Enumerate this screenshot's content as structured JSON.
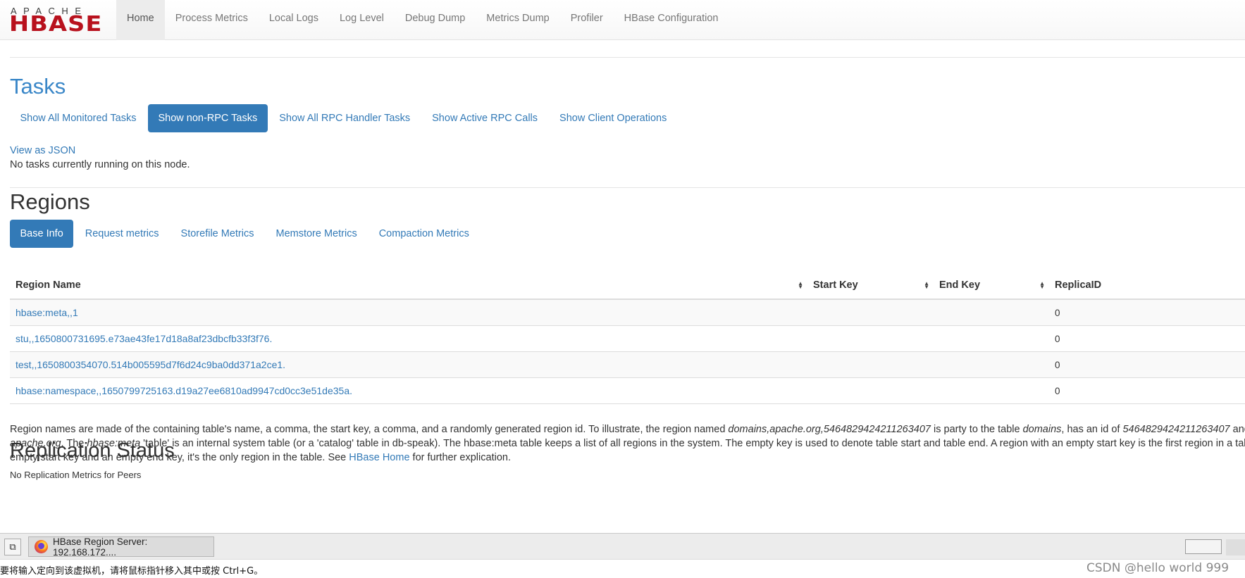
{
  "logo": {
    "top": "APACHE",
    "bottom": "HBASE"
  },
  "nav": [
    {
      "label": "Home",
      "active": true
    },
    {
      "label": "Process Metrics"
    },
    {
      "label": "Local Logs"
    },
    {
      "label": "Log Level"
    },
    {
      "label": "Debug Dump"
    },
    {
      "label": "Metrics Dump"
    },
    {
      "label": "Profiler"
    },
    {
      "label": "HBase Configuration"
    }
  ],
  "tasks": {
    "title": "Tasks",
    "tabs": [
      "Show All Monitored Tasks",
      "Show non-RPC Tasks",
      "Show All RPC Handler Tasks",
      "Show Active RPC Calls",
      "Show Client Operations"
    ],
    "active_tab": "Show non-RPC Tasks",
    "view_json": "View as JSON",
    "status": "No tasks currently running on this node."
  },
  "regions": {
    "title": "Regions",
    "tabs": [
      "Base Info",
      "Request metrics",
      "Storefile Metrics",
      "Memstore Metrics",
      "Compaction Metrics"
    ],
    "active_tab": "Base Info",
    "columns": [
      "Region Name",
      "Start Key",
      "End Key",
      "ReplicaID"
    ],
    "rows": [
      {
        "name": "hbase:meta,,1",
        "start": "",
        "end": "",
        "replica": "0"
      },
      {
        "name": "stu,,1650800731695.e73ae43fe17d18a8af23dbcfb33f3f76.",
        "start": "",
        "end": "",
        "replica": "0"
      },
      {
        "name": "test,,1650800354070.514b005595d7f6d24c9ba0dd371a2ce1.",
        "start": "",
        "end": "",
        "replica": "0"
      },
      {
        "name": "hbase:namespace,,1650799725163.d19a27ee6810ad9947cd0cc3e51de35a.",
        "start": "",
        "end": "",
        "replica": "0"
      }
    ],
    "explain": {
      "l1_a": "Region names are made of the containing table's name, a comma, the start key, a comma, and a randomly generated region id. To illustrate, the region named ",
      "l1_b": "domains,apache.org,5464829424211263407",
      "l1_c": " is party to the table ",
      "l1_d": "domains",
      "l1_e": ", has an id of ",
      "l1_f": "5464829424211263407",
      "l1_g": " and the first key of ",
      "l2_a": "apache.org",
      "l2_b": ". The ",
      "l2_c": "hbase:meta",
      "l2_d": " 'table' is an internal system table (or a 'catalog' table in db-speak). The hbase:meta table keeps a list of all regions in the system. The empty key is used to denote table start and table end. A region with an empty start key is the first region in a table. If a region has both an",
      "l3_a": "empty start key and an empty end key, it's the only region in the table. See ",
      "l3_link": "HBase Home",
      "l3_b": " for further explication."
    }
  },
  "replication": {
    "title": "Replication Status",
    "partial_text": "No Replication Metrics for Peers"
  },
  "taskbar": {
    "window_title": "HBase Region Server: 192.168.172...."
  },
  "statusbar": {
    "message": "要将输入定向到该虚拟机，请将鼠标指针移入其中或按 Ctrl+G。",
    "watermark": "CSDN @hello world 999"
  },
  "colors": {
    "link": "#337ab7",
    "logo_red": "#b8111d",
    "title_blue": "#3a87c8"
  }
}
